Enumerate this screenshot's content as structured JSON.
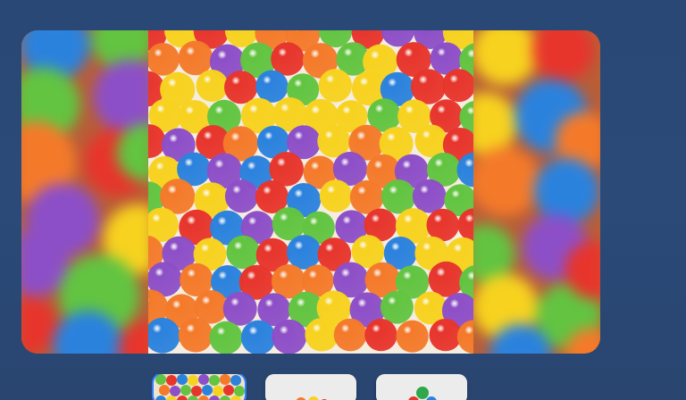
{
  "gallery": {
    "current_image": "colorful-ball-pit-image",
    "thumbnails": [
      {
        "label": "ball-pit-thumbnail",
        "selected": true
      },
      {
        "label": "stacked-balls-thumbnail",
        "selected": false
      },
      {
        "label": "single-green-ball-thumbnail",
        "selected": false
      }
    ],
    "palette": {
      "red": "#e7352c",
      "orange": "#f47a2a",
      "yellow": "#f7d21f",
      "green": "#62c441",
      "blue": "#2b82dd",
      "purple": "#8d4fc7",
      "background": "#2b4a78"
    }
  }
}
